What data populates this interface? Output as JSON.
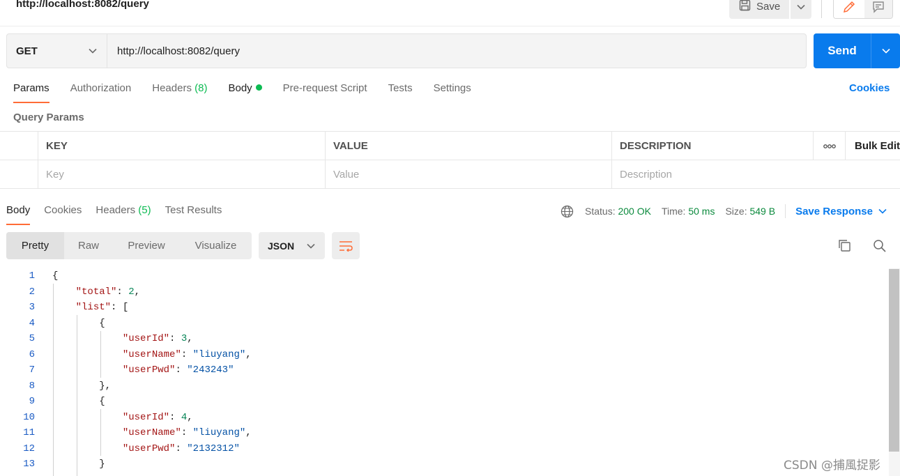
{
  "header": {
    "title": "http://localhost:8082/query",
    "save_label": "Save"
  },
  "request": {
    "method": "GET",
    "url": "http://localhost:8082/query",
    "send_label": "Send"
  },
  "request_tabs": {
    "params": "Params",
    "authorization": "Authorization",
    "headers": "Headers",
    "headers_count": "(8)",
    "body": "Body",
    "prerequest": "Pre-request Script",
    "tests": "Tests",
    "settings": "Settings",
    "cookies": "Cookies"
  },
  "query_params": {
    "title": "Query Params",
    "columns": {
      "key": "KEY",
      "value": "VALUE",
      "description": "DESCRIPTION",
      "more": "ooo",
      "bulk_edit": "Bulk Edit"
    },
    "placeholders": {
      "key": "Key",
      "value": "Value",
      "description": "Description"
    }
  },
  "response_tabs": {
    "body": "Body",
    "cookies": "Cookies",
    "headers": "Headers",
    "headers_count": "(5)",
    "test_results": "Test Results"
  },
  "response_status": {
    "status_label": "Status:",
    "status_value": "200 OK",
    "time_label": "Time:",
    "time_value": "50 ms",
    "size_label": "Size:",
    "size_value": "549 B",
    "save_response": "Save Response"
  },
  "view_tabs": [
    "Pretty",
    "Raw",
    "Preview",
    "Visualize"
  ],
  "format": "JSON",
  "code_lines": [
    {
      "n": "1",
      "parts": [
        [
          "p",
          "{"
        ]
      ]
    },
    {
      "n": "2",
      "parts": [
        [
          "p",
          "    "
        ],
        [
          "k",
          "\"total\""
        ],
        [
          "p",
          ": "
        ],
        [
          "n",
          "2"
        ],
        [
          "p",
          ","
        ]
      ]
    },
    {
      "n": "3",
      "parts": [
        [
          "p",
          "    "
        ],
        [
          "k",
          "\"list\""
        ],
        [
          "p",
          ": ["
        ]
      ]
    },
    {
      "n": "4",
      "parts": [
        [
          "p",
          "        {"
        ]
      ]
    },
    {
      "n": "5",
      "parts": [
        [
          "p",
          "            "
        ],
        [
          "k",
          "\"userId\""
        ],
        [
          "p",
          ": "
        ],
        [
          "n",
          "3"
        ],
        [
          "p",
          ","
        ]
      ]
    },
    {
      "n": "6",
      "parts": [
        [
          "p",
          "            "
        ],
        [
          "k",
          "\"userName\""
        ],
        [
          "p",
          ": "
        ],
        [
          "s",
          "\"liuyang\""
        ],
        [
          "p",
          ","
        ]
      ]
    },
    {
      "n": "7",
      "parts": [
        [
          "p",
          "            "
        ],
        [
          "k",
          "\"userPwd\""
        ],
        [
          "p",
          ": "
        ],
        [
          "s",
          "\"243243\""
        ]
      ]
    },
    {
      "n": "8",
      "parts": [
        [
          "p",
          "        },"
        ]
      ]
    },
    {
      "n": "9",
      "parts": [
        [
          "p",
          "        {"
        ]
      ]
    },
    {
      "n": "10",
      "parts": [
        [
          "p",
          "            "
        ],
        [
          "k",
          "\"userId\""
        ],
        [
          "p",
          ": "
        ],
        [
          "n",
          "4"
        ],
        [
          "p",
          ","
        ]
      ]
    },
    {
      "n": "11",
      "parts": [
        [
          "p",
          "            "
        ],
        [
          "k",
          "\"userName\""
        ],
        [
          "p",
          ": "
        ],
        [
          "s",
          "\"liuyang\""
        ],
        [
          "p",
          ","
        ]
      ]
    },
    {
      "n": "12",
      "parts": [
        [
          "p",
          "            "
        ],
        [
          "k",
          "\"userPwd\""
        ],
        [
          "p",
          ": "
        ],
        [
          "s",
          "\"2132312\""
        ]
      ]
    },
    {
      "n": "13",
      "parts": [
        [
          "p",
          "        }"
        ]
      ]
    }
  ],
  "watermark": "CSDN @捕風捉影",
  "colors": {
    "accent": "#097bed",
    "tab_indicator": "#ff6c37",
    "success": "#0cbb52"
  }
}
